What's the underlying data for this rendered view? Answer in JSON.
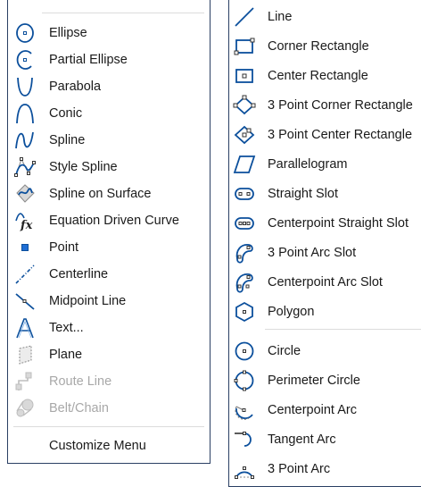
{
  "left_menu": {
    "items": [
      {
        "label": "Ellipse",
        "icon": "ellipse-icon",
        "enabled": true
      },
      {
        "label": "Partial Ellipse",
        "icon": "partial-ellipse-icon",
        "enabled": true
      },
      {
        "label": "Parabola",
        "icon": "parabola-icon",
        "enabled": true
      },
      {
        "label": "Conic",
        "icon": "conic-icon",
        "enabled": true
      },
      {
        "label": "Spline",
        "icon": "spline-icon",
        "enabled": true
      },
      {
        "label": "Style Spline",
        "icon": "style-spline-icon",
        "enabled": true
      },
      {
        "label": "Spline on Surface",
        "icon": "spline-on-surface-icon",
        "enabled": true
      },
      {
        "label": "Equation Driven Curve",
        "icon": "equation-driven-curve-icon",
        "enabled": true
      },
      {
        "label": "Point",
        "icon": "point-icon",
        "enabled": true
      },
      {
        "label": "Centerline",
        "icon": "centerline-icon",
        "enabled": true
      },
      {
        "label": "Midpoint Line",
        "icon": "midpoint-line-icon",
        "enabled": true
      },
      {
        "label": "Text...",
        "icon": "text-icon",
        "enabled": true
      },
      {
        "label": "Plane",
        "icon": "plane-icon",
        "enabled": true
      },
      {
        "label": "Route Line",
        "icon": "route-line-icon",
        "enabled": false
      },
      {
        "label": "Belt/Chain",
        "icon": "belt-chain-icon",
        "enabled": false
      }
    ],
    "footer": {
      "label": "Customize Menu"
    }
  },
  "right_menu": {
    "items": [
      {
        "label": "Line",
        "icon": "line-icon",
        "enabled": true
      },
      {
        "label": "Corner Rectangle",
        "icon": "corner-rectangle-icon",
        "enabled": true
      },
      {
        "label": "Center Rectangle",
        "icon": "center-rectangle-icon",
        "enabled": true
      },
      {
        "label": "3 Point Corner Rectangle",
        "icon": "3-point-corner-rectangle-icon",
        "enabled": true
      },
      {
        "label": "3 Point Center Rectangle",
        "icon": "3-point-center-rectangle-icon",
        "enabled": true
      },
      {
        "label": "Parallelogram",
        "icon": "parallelogram-icon",
        "enabled": true
      },
      {
        "label": "Straight Slot",
        "icon": "straight-slot-icon",
        "enabled": true
      },
      {
        "label": "Centerpoint Straight Slot",
        "icon": "centerpoint-straight-slot-icon",
        "enabled": true
      },
      {
        "label": "3 Point Arc Slot",
        "icon": "3-point-arc-slot-icon",
        "enabled": true
      },
      {
        "label": "Centerpoint Arc Slot",
        "icon": "centerpoint-arc-slot-icon",
        "enabled": true
      },
      {
        "label": "Polygon",
        "icon": "polygon-icon",
        "enabled": true
      },
      {
        "label": "Circle",
        "icon": "circle-icon",
        "enabled": true
      },
      {
        "label": "Perimeter Circle",
        "icon": "perimeter-circle-icon",
        "enabled": true
      },
      {
        "label": "Centerpoint Arc",
        "icon": "centerpoint-arc-icon",
        "enabled": true
      },
      {
        "label": "Tangent Arc",
        "icon": "tangent-arc-icon",
        "enabled": true
      },
      {
        "label": "3 Point Arc",
        "icon": "3-point-arc-icon",
        "enabled": true
      }
    ]
  },
  "colors": {
    "border": "#2a3f63",
    "icon_blue": "#0b4f9c",
    "disabled_text": "#a8a8a8"
  }
}
